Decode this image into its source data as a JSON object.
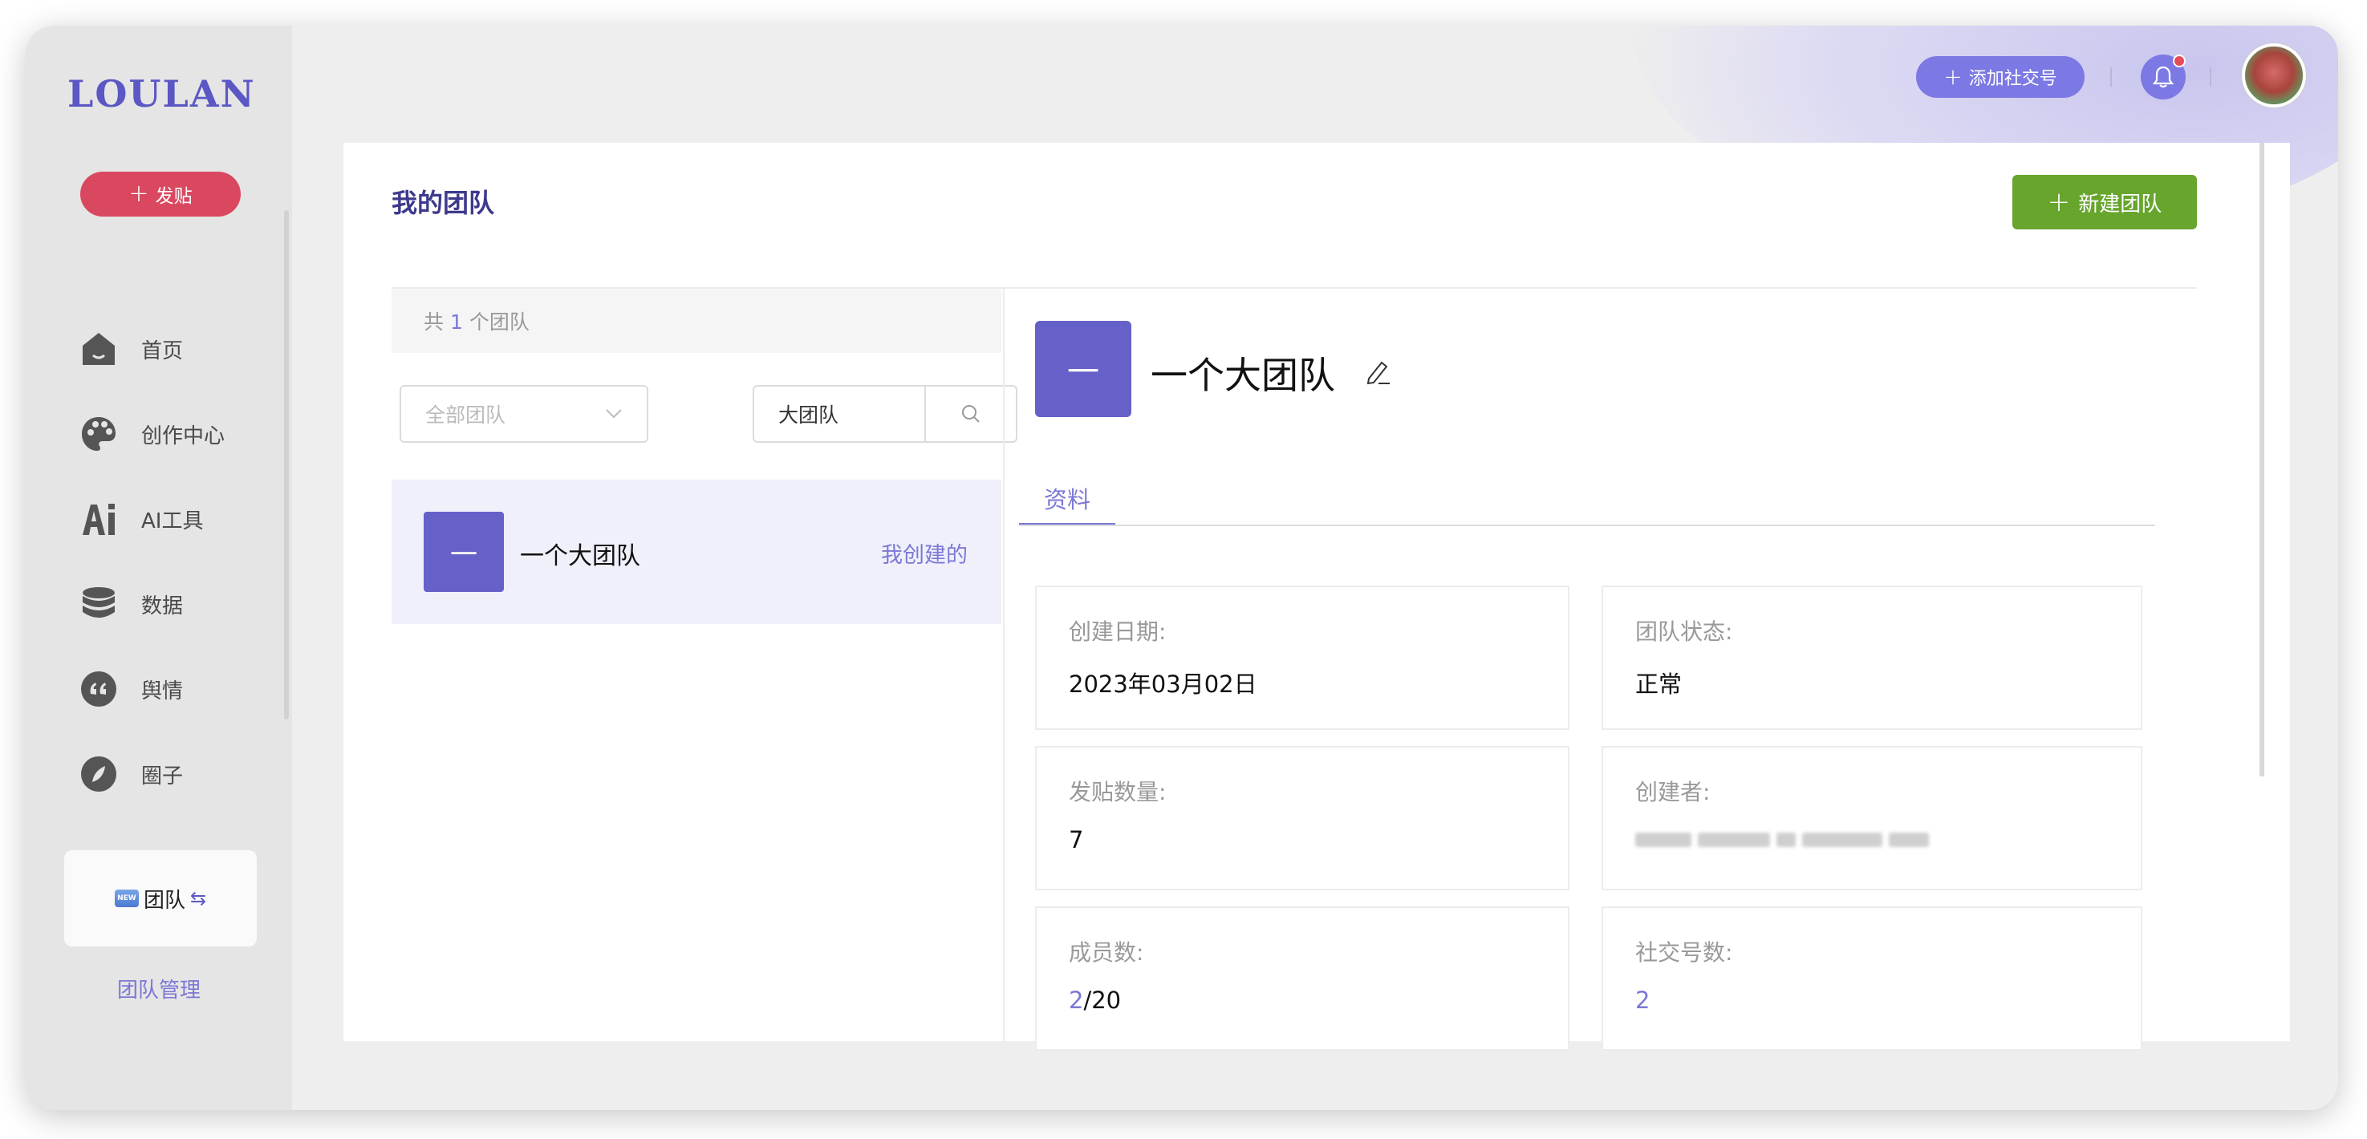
{
  "brand": {
    "logo": "LOULAN"
  },
  "sidebar": {
    "post_button": "发贴",
    "items": [
      {
        "label": "首页",
        "icon": "home-icon"
      },
      {
        "label": "创作中心",
        "icon": "palette-icon"
      },
      {
        "label": "AI工具",
        "icon": "ai-icon"
      },
      {
        "label": "数据",
        "icon": "database-icon"
      },
      {
        "label": "舆情",
        "icon": "quote-icon"
      },
      {
        "label": "圈子",
        "icon": "compass-icon"
      }
    ],
    "team_switch": {
      "badge": "NEW",
      "label": "团队"
    },
    "team_manage": "团队管理"
  },
  "topbar": {
    "add_social": "添加社交号"
  },
  "page": {
    "title": "我的团队",
    "new_team_button": "新建团队",
    "list": {
      "count_prefix": "共",
      "count": "1",
      "count_suffix": "个团队",
      "filter_placeholder": "全部团队",
      "search_value": "大团队",
      "teams": [
        {
          "avatar_text": "一",
          "name": "一个大团队",
          "tag": "我创建的"
        }
      ]
    },
    "detail": {
      "avatar_text": "一",
      "name": "一个大团队",
      "tab": "资料",
      "fields": {
        "created_label": "创建日期:",
        "created_value": "2023年03月02日",
        "status_label": "团队状态:",
        "status_value": "正常",
        "posts_label": "发贴数量:",
        "posts_value": "7",
        "creator_label": "创建者:",
        "members_label": "成员数:",
        "members_current": "2",
        "members_max": "/20",
        "social_label": "社交号数:",
        "social_value": "2"
      }
    }
  },
  "colors": {
    "accent": "#7b78d6",
    "post": "#d9485f",
    "primary_green": "#67a52d",
    "avatar": "#6661c9"
  }
}
